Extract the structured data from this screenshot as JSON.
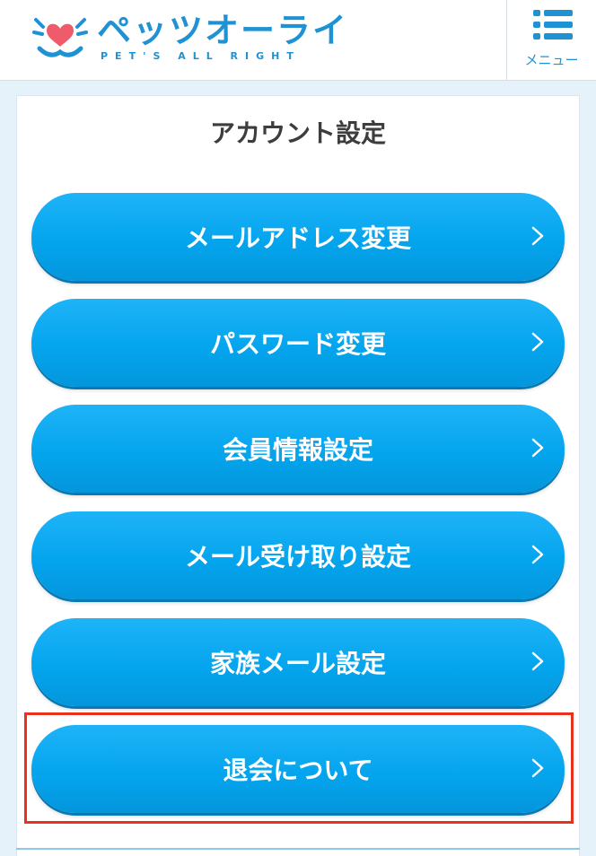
{
  "header": {
    "logo_text": "ペッツオーライ",
    "logo_sub": "PET'S ALL RIGHT",
    "menu_label": "メニュー"
  },
  "page": {
    "title": "アカウント設定"
  },
  "buttons": [
    {
      "label": "メールアドレス変更"
    },
    {
      "label": "パスワード変更"
    },
    {
      "label": "会員情報設定"
    },
    {
      "label": "メール受け取り設定"
    },
    {
      "label": "家族メール設定"
    },
    {
      "label": "退会について"
    }
  ],
  "colors": {
    "brand": "#1f92d4",
    "button": "#04a5ee",
    "highlight": "#e8321e",
    "logo_heart": "#ef5b6b"
  }
}
